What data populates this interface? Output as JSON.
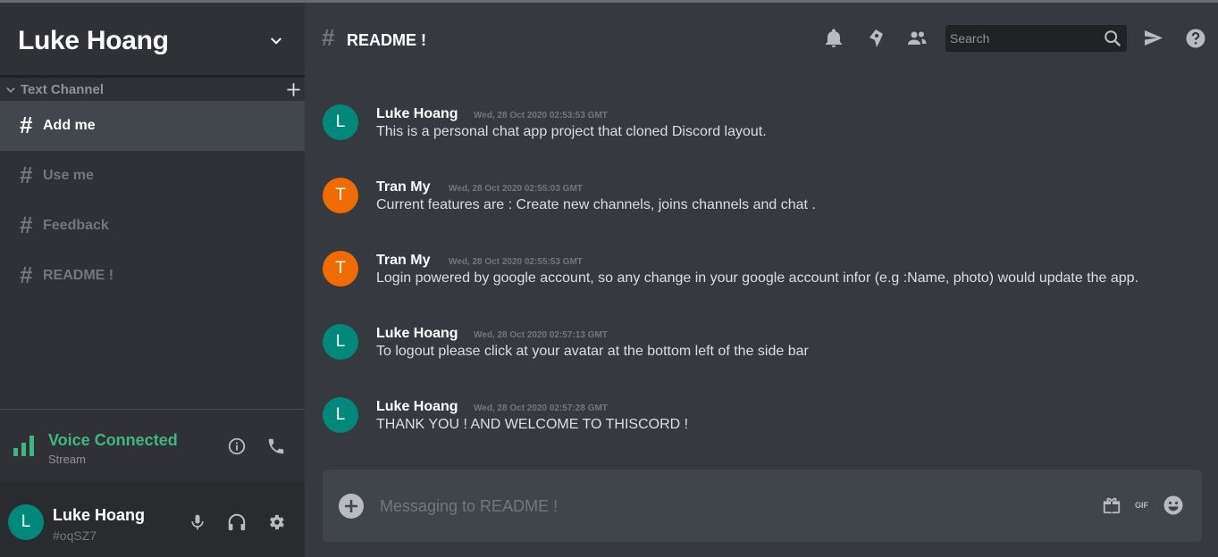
{
  "server": {
    "name": "Luke Hoang"
  },
  "sidebar": {
    "section_label": "Text Channel",
    "channels": [
      {
        "label": "Add me",
        "active": true
      },
      {
        "label": "Use me",
        "active": false
      },
      {
        "label": "Feedback",
        "active": false
      },
      {
        "label": "README !",
        "active": false
      }
    ]
  },
  "voice": {
    "title": "Voice Connected",
    "subtitle": "Stream"
  },
  "user": {
    "avatar_letter": "L",
    "name": "Luke Hoang",
    "tag": "#oqSZ7"
  },
  "channel_header": {
    "hash": "#",
    "title": "README !",
    "search_placeholder": "Search"
  },
  "messages": [
    {
      "avatar_letter": "L",
      "avatar_color": "#00897b",
      "author": "Luke Hoang",
      "time": "Wed, 28 Oct 2020 02:53:53 GMT",
      "text": "This is a personal chat app project that cloned Discord layout."
    },
    {
      "avatar_letter": "T",
      "avatar_color": "#ef6c00",
      "author": "Tran My",
      "time": "Wed, 28 Oct 2020 02:55:03 GMT",
      "text": "Current features are : Create new channels, joins channels and chat ."
    },
    {
      "avatar_letter": "T",
      "avatar_color": "#ef6c00",
      "author": "Tran My",
      "time": "Wed, 28 Oct 2020 02:55:53 GMT",
      "text": "Login powered by google account, so any change in your google account infor (e.g :Name, photo) would update the app."
    },
    {
      "avatar_letter": "L",
      "avatar_color": "#00897b",
      "author": "Luke Hoang",
      "time": "Wed, 28 Oct 2020 02:57:13 GMT",
      "text": "To logout please click at your avatar at the bottom left of the side bar"
    },
    {
      "avatar_letter": "L",
      "avatar_color": "#00897b",
      "author": "Luke Hoang",
      "time": "Wed, 28 Oct 2020 02:57:28 GMT",
      "text": "THANK YOU ! AND WELCOME TO THISCORD !"
    }
  ],
  "composer": {
    "placeholder": "Messaging to README !",
    "gif_label": "GIF"
  },
  "colors": {
    "voice_green": "#43b581",
    "luke_avatar": "#00897b",
    "tran_avatar": "#ef6c00"
  },
  "icons": [
    "chevron-down-icon",
    "plus-icon",
    "hash-icon",
    "signal-icon",
    "info-icon",
    "phone-icon",
    "mic-icon",
    "headphones-icon",
    "gear-icon",
    "bell-icon",
    "pin-icon",
    "members-icon",
    "search-icon",
    "send-icon",
    "help-icon",
    "add-attachment-icon",
    "gift-icon",
    "gif-icon",
    "emoji-icon"
  ]
}
